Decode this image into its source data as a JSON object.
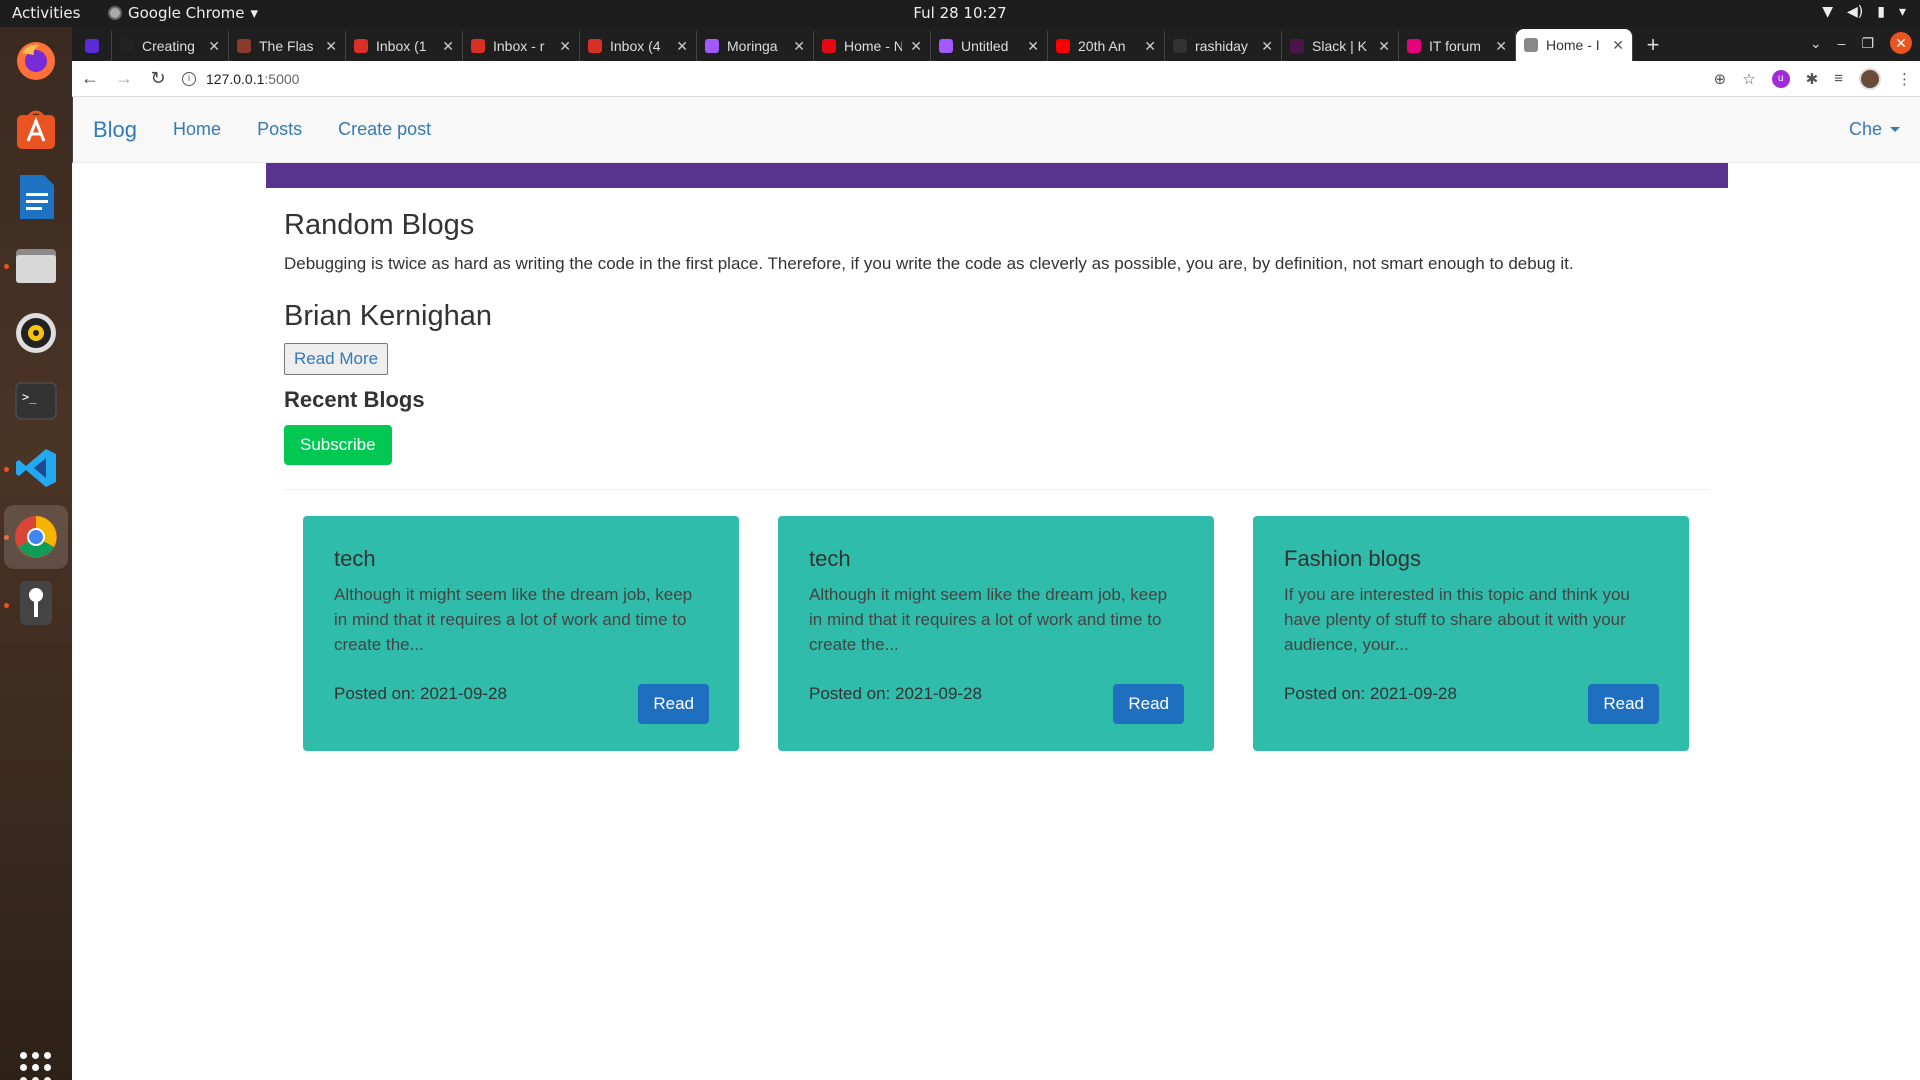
{
  "system": {
    "activities": "Activities",
    "app_name": "Google Chrome",
    "clock": "Ful 28  10:27"
  },
  "browser": {
    "tabs": [
      {
        "title": "Creating",
        "color": "#222222"
      },
      {
        "title": "The Flas",
        "color": "#8a3b2b"
      },
      {
        "title": "Inbox (1",
        "color": "#d93025"
      },
      {
        "title": "Inbox - r",
        "color": "#d93025"
      },
      {
        "title": "Inbox (4",
        "color": "#d93025"
      },
      {
        "title": "Moringa",
        "color": "#a259ff"
      },
      {
        "title": "Home - N",
        "color": "#e50914"
      },
      {
        "title": "Untitled",
        "color": "#a259ff"
      },
      {
        "title": "20th An",
        "color": "#ff0000"
      },
      {
        "title": "rashiday",
        "color": "#333333"
      },
      {
        "title": "Slack | K",
        "color": "#4a154b"
      },
      {
        "title": "IT forum",
        "color": "#e5007d"
      },
      {
        "title": "Home - I",
        "color": "#888888"
      }
    ],
    "url_host": "127.0.0.1",
    "url_port": ":5000"
  },
  "navbar": {
    "brand": "Blog",
    "links": [
      "Home",
      "Posts",
      "Create post"
    ],
    "user": "Che"
  },
  "hero": {
    "heading": "Random Blogs",
    "quote": "Debugging is twice as hard as writing the code in the first place. Therefore, if you write the code as cleverly as possible, you are, by definition, not smart enough to debug it.",
    "author": "Brian Kernighan",
    "read_more": "Read More"
  },
  "recent": {
    "heading": "Recent Blogs",
    "subscribe": "Subscribe"
  },
  "posts": [
    {
      "title": "tech",
      "excerpt": "Although it might seem like the dream job, keep in mind that it requires a lot of work and time to create the...",
      "date": "Posted on: 2021-09-28",
      "button": "Read"
    },
    {
      "title": "tech",
      "excerpt": "Although it might seem like the dream job, keep in mind that it requires a lot of work and time to create the...",
      "date": "Posted on: 2021-09-28",
      "button": "Read"
    },
    {
      "title": "Fashion blogs",
      "excerpt": "If you are interested in this topic and think you have plenty of stuff to share about it with your audience, your...",
      "date": "Posted on: 2021-09-28",
      "button": "Read"
    }
  ],
  "colors": {
    "banner": "#5a3390",
    "card": "#2fbcaa",
    "subscribe": "#00c853",
    "read": "#1e6fbf",
    "link": "#337ab7"
  }
}
